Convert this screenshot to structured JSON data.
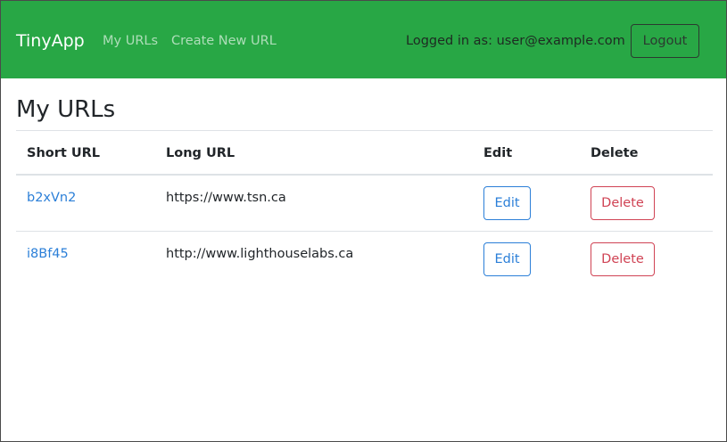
{
  "navbar": {
    "brand": "TinyApp",
    "links": [
      {
        "label": "My URLs"
      },
      {
        "label": "Create New URL"
      }
    ],
    "logged_in_text": "Logged in as: user@example.com",
    "logout_label": "Logout",
    "background_color": "#28a745"
  },
  "page": {
    "title": "My URLs"
  },
  "table": {
    "headers": {
      "short_url": "Short URL",
      "long_url": "Long URL",
      "edit": "Edit",
      "delete": "Delete"
    },
    "rows": [
      {
        "short_url": "b2xVn2",
        "long_url": "https://www.tsn.ca",
        "edit_label": "Edit",
        "delete_label": "Delete"
      },
      {
        "short_url": "i8Bf45",
        "long_url": "http://www.lighthouselabs.ca",
        "edit_label": "Edit",
        "delete_label": "Delete"
      }
    ]
  },
  "colors": {
    "link": "#2b7fd8",
    "danger": "#d04354",
    "text": "#212529"
  }
}
